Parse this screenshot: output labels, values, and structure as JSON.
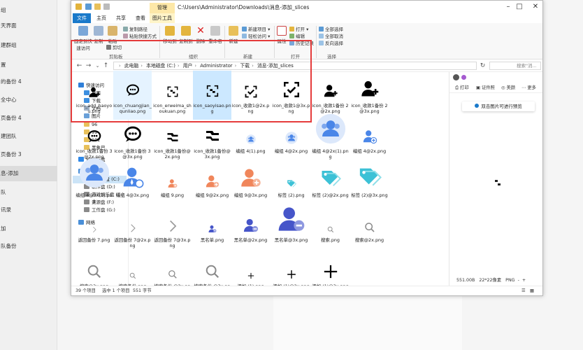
{
  "background": {
    "sidebar_items": [
      "组",
      "天界面",
      "建群组",
      "置",
      "的备份 4",
      "全中心",
      "页备份 4",
      "建团队",
      "页备份 3",
      "息-添加",
      "队",
      "讯录",
      "加",
      "队备份"
    ]
  },
  "window": {
    "manage_tab": "管理",
    "title_path": "C:\\Users\\Administrator\\Downloads\\消息-添加_slices",
    "controls": [
      "–",
      "□",
      "✕"
    ],
    "ribbon_tabs": [
      "文件",
      "主页",
      "共享",
      "查看",
      "图片工具"
    ]
  },
  "ribbon": {
    "pin_quick": "固定到快速访问",
    "copy": "复制",
    "paste": "粘贴",
    "copy_path": "复制路径",
    "paste_shortcut": "粘贴快捷方式",
    "cut": "剪切",
    "move_to": "移动到",
    "copy_to": "复制到",
    "delete": "删除",
    "rename": "重命名",
    "new_folder": "新建",
    "new_item": "新建项目 ▾",
    "easy_access": "轻松访问 ▾",
    "properties": "属性",
    "open": "打开 ▾",
    "edit": "编辑",
    "history": "历史记录",
    "select_all": "全部选择",
    "select_none": "全部取消",
    "invert": "反向选择",
    "groups": {
      "clipboard": "剪贴板",
      "organize": "组织",
      "new": "新建",
      "open": "打开",
      "select": "选择"
    }
  },
  "address": {
    "crumbs": [
      "此电脑",
      "本地磁盘 (C:)",
      "用户",
      "Administrator",
      "下载",
      "消息-添加_slices"
    ],
    "search_placeholder": "搜索\"消..."
  },
  "nav": {
    "quick_access": "快速访问",
    "desktop": "桌面",
    "downloads": "下载",
    "documents": "文档",
    "pictures": "图片",
    "f96": "96",
    "f99": "99",
    "f102": "102",
    "camera": "黑象巴",
    "wps": "WPS云盘",
    "this_pc": "此电脑",
    "c_drive": "本地磁盘 (C:)",
    "d_drive": "软件盘 (D:)",
    "e_drive": "游戏娱乐盘 (E:)",
    "f_drive": "资源盘 (F:)",
    "g_drive": "工作盘 (G:)",
    "network": "网络"
  },
  "files": [
    {
      "name": "icon_add_haoyou.png",
      "icon": "add-friend-icon"
    },
    {
      "name": "icon_chuangjian_qunliao.png",
      "icon": "create-group-chat-icon"
    },
    {
      "name": "icon_erweima_shoukuan.png",
      "icon": "qr-code-icon"
    },
    {
      "name": "icon_saoyisao.png",
      "icon": "scan-icon"
    },
    {
      "name": "icon_收款1@2x.png",
      "icon": "scan-frame-icon"
    },
    {
      "name": "icon_收款1@3x.png",
      "icon": "scan-frame-icon"
    },
    {
      "name": "icon_收款1备份 2@2x.png",
      "icon": "add-user-icon"
    },
    {
      "name": "icon_收款1备份 2@3x.png",
      "icon": "add-user-icon"
    },
    {
      "name": "icon_收款1备份 3@2x.png",
      "icon": "chat-bubble-icon"
    },
    {
      "name": "icon_收款1备份 3@3x.png",
      "icon": "chat-bubble-icon"
    },
    {
      "name": "icon_收款1备份@2x.png",
      "icon": "swap-icon"
    },
    {
      "name": "icon_收款1备份@3x.png",
      "icon": "swap-icon"
    },
    {
      "name": "编组 4(1).png",
      "icon": "group-avatar-icon"
    },
    {
      "name": "编组 4@2x.png",
      "icon": "group-avatar-icon"
    },
    {
      "name": "编组 4@2x(1).png",
      "icon": "group-avatar-icon"
    },
    {
      "name": "编组 4@2x.png",
      "icon": "group-add-icon"
    },
    {
      "name": "编组 4@3x(1).png",
      "icon": "group-avatar-icon"
    },
    {
      "name": "编组 4@3x.png",
      "icon": "user-tie-icon"
    },
    {
      "name": "编组 9.png",
      "icon": "user-add-icon"
    },
    {
      "name": "编组 9@2x.png",
      "icon": "user-add-icon"
    },
    {
      "name": "编组 9@3x.png",
      "icon": "user-add-icon"
    },
    {
      "name": "标签 (2).png",
      "icon": "tag-icon"
    },
    {
      "name": "标签 (2)@2x.png",
      "icon": "tag-icon"
    },
    {
      "name": "标签 (2)@3x.png",
      "icon": "tag-icon"
    },
    {
      "name": "返回备份 7.png",
      "icon": "chevron-right-icon"
    },
    {
      "name": "返回备份 7@2x.png",
      "icon": "chevron-right-icon"
    },
    {
      "name": "返回备份 7@3x.png",
      "icon": "chevron-right-icon"
    },
    {
      "name": "黑名单.png",
      "icon": "blacklist-icon"
    },
    {
      "name": "黑名单@2x.png",
      "icon": "blacklist-icon"
    },
    {
      "name": "黑名单@3x.png",
      "icon": "blacklist-icon"
    },
    {
      "name": "搜索.png",
      "icon": "search-icon"
    },
    {
      "name": "搜索@2x.png",
      "icon": "search-icon"
    },
    {
      "name": "搜索@3x.png",
      "icon": "search-icon"
    },
    {
      "name": "搜索备份.png",
      "icon": "search-icon"
    },
    {
      "name": "搜索备份 @2x.png",
      "icon": "search-icon"
    },
    {
      "name": "搜索备份 @3x.png",
      "icon": "search-icon"
    },
    {
      "name": "添加 (1).png",
      "icon": "plus-icon"
    },
    {
      "name": "添加 (1)@2x.png",
      "icon": "plus-icon"
    },
    {
      "name": "添加 (1)@3x.png",
      "icon": "plus-icon"
    }
  ],
  "preview": {
    "print": "打印",
    "certificate": "证件照",
    "beauty": "美颜",
    "more": "更多",
    "tip": "双击图片可进行预览",
    "size": "551.00B",
    "dims": "22*22像素",
    "format": "PNG",
    "zoom_in": "+",
    "zoom_out": "-"
  },
  "status": {
    "count": "39 个项目",
    "selected": "选中 1 个项目",
    "size": "551 字节"
  },
  "colors": {
    "accent": "#1979ca",
    "icon_blue": "#4a86e8",
    "icon_orange": "#f0865b",
    "tag_cyan": "#3cc1d6",
    "highlight": "#e53b3b"
  }
}
